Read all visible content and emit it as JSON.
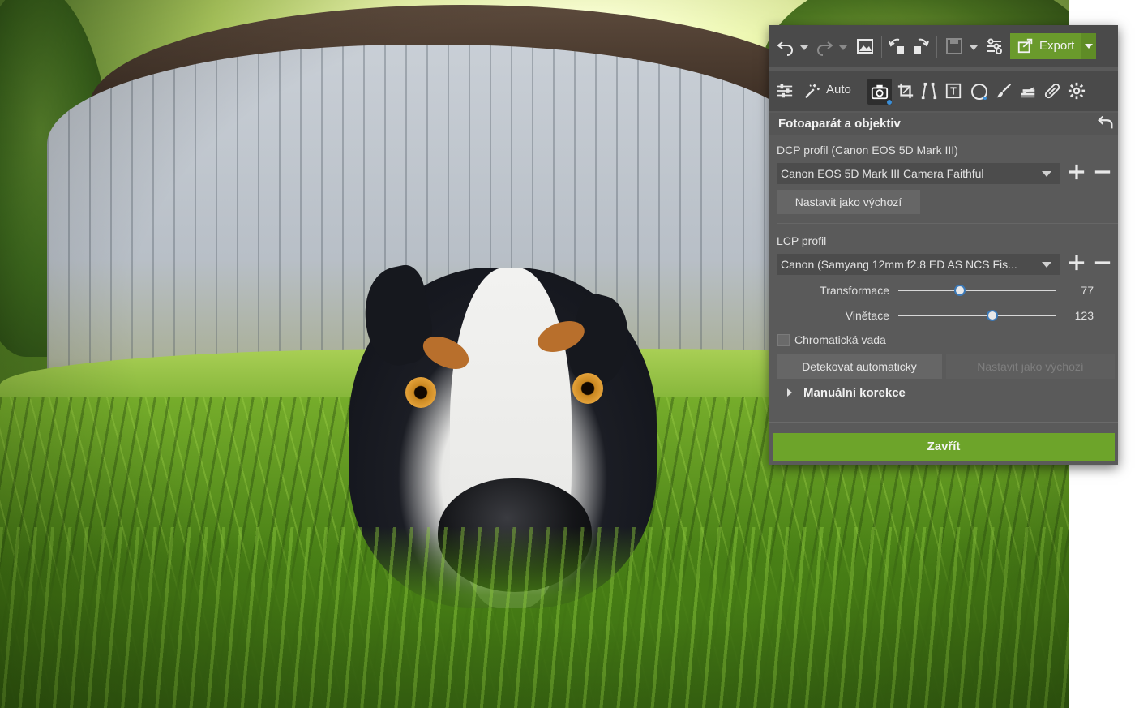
{
  "toolbar": {
    "icons": [
      "undo-icon",
      "redo-icon",
      "image-icon",
      "rotate-left-icon",
      "rotate-right-icon",
      "save-icon",
      "settings-sliders-icon",
      "export-icon"
    ],
    "export_label": "Export"
  },
  "tools": {
    "auto_label": "Auto",
    "icons": [
      "adjust-sliders-icon",
      "magic-wand-icon",
      "camera-icon",
      "crop-icon",
      "perspective-icon",
      "text-frame-icon",
      "circle-icon",
      "brush-icon",
      "gradient-icon",
      "bandage-icon",
      "gear-icon"
    ]
  },
  "section": {
    "title": "Fotoaparát a objektiv"
  },
  "dcp": {
    "label": "DCP profil (Canon EOS 5D Mark III)",
    "selected": "Canon EOS 5D Mark III Camera Faithful",
    "set_default_label": "Nastavit jako výchozí"
  },
  "lcp": {
    "label": "LCP profil",
    "selected": "Canon (Samyang 12mm f2.8 ED AS NCS Fis..."
  },
  "sliders": [
    {
      "label": "Transformace",
      "value": "77",
      "fraction": 0.39
    },
    {
      "label": "Vinětace",
      "value": "123",
      "fraction": 0.6
    }
  ],
  "chromatic": {
    "label": "Chromatická vada",
    "checked": false
  },
  "actions": {
    "detect_label": "Detekovat automaticky",
    "set_default_label": "Nastavit jako výchozí"
  },
  "manual": {
    "label": "Manuální korekce"
  },
  "close_label": "Zavřít",
  "colors": {
    "accent_green": "#6da42a",
    "panel_bg": "#5a5a5a",
    "toolbar_bg": "#4a4a4a"
  }
}
